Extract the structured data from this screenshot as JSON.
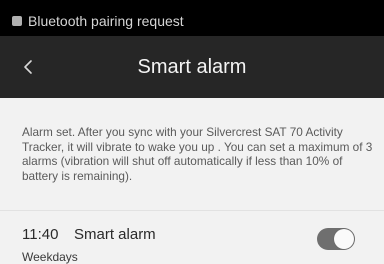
{
  "status_bar": {
    "notification_icon": "bluetooth-notification-icon",
    "notification_text": "Bluetooth pairing request"
  },
  "action_bar": {
    "back_icon": "chevron-left-icon",
    "title": "Smart alarm"
  },
  "description": "Alarm set. After you sync with your Silvercrest SAT 70 Activity Tracker, it will vibrate to wake you up . You can set a maximum of 3 alarms (vibration will shut off automatically if less than 10% of battery is remaining).",
  "alarm": {
    "time": "11:40",
    "label": "Smart alarm",
    "repeat": "Weekdays",
    "enabled": true
  },
  "colors": {
    "status_bar": "#000000",
    "action_bar": "#262626",
    "background": "#f2f2f2",
    "toggle_on": "#6f6f6f"
  }
}
